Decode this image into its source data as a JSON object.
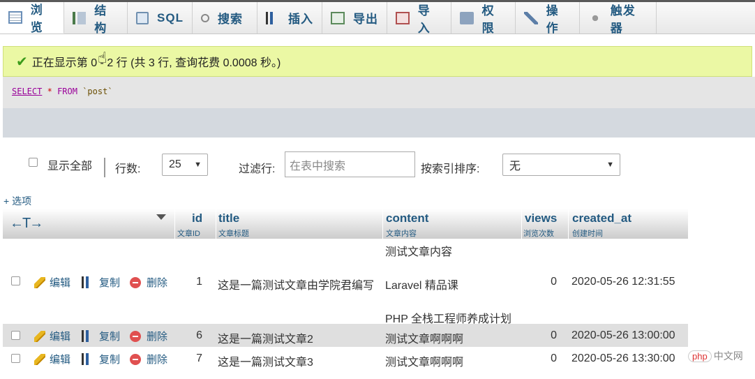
{
  "tabs": [
    {
      "label": "浏览",
      "icon": "browse-icon",
      "active": true
    },
    {
      "label": "结构",
      "icon": "structure-icon"
    },
    {
      "label": "SQL",
      "icon": "sql-icon"
    },
    {
      "label": "搜索",
      "icon": "search-icon"
    },
    {
      "label": "插入",
      "icon": "insert-icon"
    },
    {
      "label": "导出",
      "icon": "export-icon"
    },
    {
      "label": "导入",
      "icon": "import-icon"
    },
    {
      "label": "权限",
      "icon": "privileges-icon"
    },
    {
      "label": "操作",
      "icon": "operations-icon"
    },
    {
      "label": "触发器",
      "icon": "triggers-icon"
    }
  ],
  "success": {
    "message": "正在显示第 0 - 2 行 (共 3 行, 查询花费 0.0008 秒。)",
    "color": "#ebf8a4"
  },
  "sql": {
    "select": "SELECT",
    "star": "*",
    "from": "FROM",
    "table": "`post`"
  },
  "controls": {
    "show_all": "显示全部",
    "rows_label": "行数:",
    "rows_value": "25",
    "filter_label": "过滤行:",
    "filter_placeholder": "在表中搜索",
    "sort_label": "按索引排序:",
    "sort_value": "无"
  },
  "options_link": "+ 选项",
  "table": {
    "nav": "←T→",
    "columns": [
      {
        "name": "id",
        "comment": "文章ID"
      },
      {
        "name": "title",
        "comment": "文章标题"
      },
      {
        "name": "content",
        "comment": "文章内容"
      },
      {
        "name": "views",
        "comment": "浏览次数"
      },
      {
        "name": "created_at",
        "comment": "创建时间"
      }
    ],
    "actions": {
      "edit": "编辑",
      "copy": "复制",
      "delete": "删除"
    },
    "rows": [
      {
        "id": "1",
        "title": "这是一篇测试文章由学院君编写",
        "content_lines": [
          "测试文章内容",
          "Laravel 精品课",
          "PHP 全栈工程师养成计划"
        ],
        "views": "0",
        "created_at": "2020-05-26 12:31:55"
      },
      {
        "id": "6",
        "title": "这是一篇测试文章2",
        "content_lines": [
          "测试文章啊啊啊"
        ],
        "views": "0",
        "created_at": "2020-05-26 13:00:00"
      },
      {
        "id": "7",
        "title": "这是一篇测试文章3",
        "content_lines": [
          "测试文章啊啊啊"
        ],
        "views": "0",
        "created_at": "2020-05-26 13:30:00"
      }
    ]
  },
  "watermark": {
    "badge": "php",
    "text": "中文网"
  }
}
